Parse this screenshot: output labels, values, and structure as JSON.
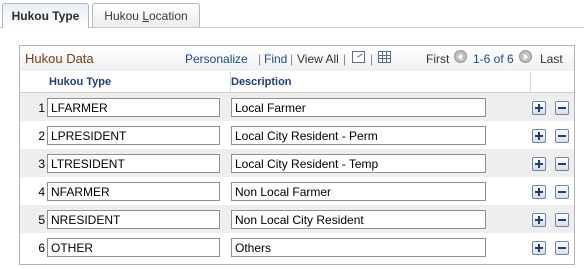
{
  "tabs": {
    "active_label": "Hukou Type",
    "inactive_label_pre": "Hukou ",
    "inactive_label_ul": "L",
    "inactive_label_post": "ocation"
  },
  "grid": {
    "title": "Hukou Data",
    "personalize": "Personalize",
    "find": "Find",
    "view_all": "View All",
    "separator": "|",
    "first": "First",
    "range": "1-6 of 6",
    "last": "Last",
    "col_type": "Hukou Type",
    "col_desc": "Description",
    "rows": [
      {
        "num": "1",
        "type": "LFARMER",
        "desc": "Local Farmer"
      },
      {
        "num": "2",
        "type": "LPRESIDENT",
        "desc": "Local City Resident - Perm"
      },
      {
        "num": "3",
        "type": "LTRESIDENT",
        "desc": "Local City Resident - Temp"
      },
      {
        "num": "4",
        "type": "NFARMER",
        "desc": "Non Local Farmer"
      },
      {
        "num": "5",
        "type": "NRESIDENT",
        "desc": "Non Local City Resident"
      },
      {
        "num": "6",
        "type": "OTHER",
        "desc": "Others"
      }
    ]
  },
  "icons": {
    "zoom": "zoom-icon",
    "download": "grid-download-icon",
    "prev": "prev-circle-icon",
    "next": "next-circle-icon",
    "add": "add-row-icon",
    "delete": "delete-row-icon"
  }
}
